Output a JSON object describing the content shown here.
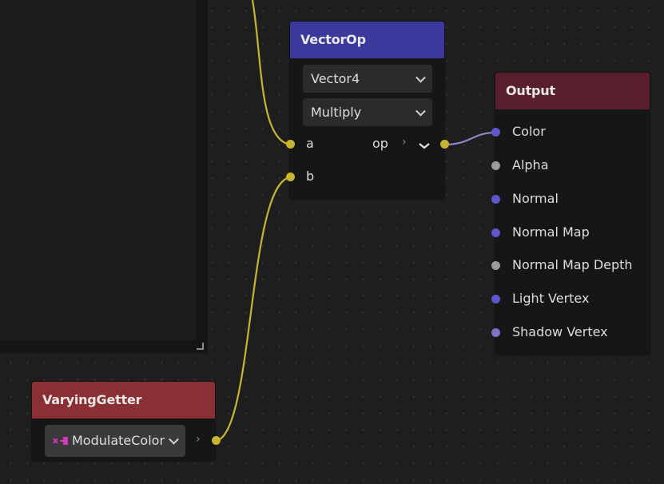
{
  "colors": {
    "background": "#1e1e1e",
    "wire": "#c9b431",
    "wire_to_output": "#8d86c4",
    "vectorop_header": "#3b3a9c",
    "output_header": "#5a1f2c",
    "varying_header": "#8a2f33",
    "port_float": "#9b9b9b",
    "port_vector": "#5d58c9"
  },
  "vector_op": {
    "title": "VectorOp",
    "type_select": "Vector4",
    "op_select": "Multiply",
    "inputs": [
      {
        "label": "a",
        "icon": "yellow-port-icon"
      },
      {
        "label": "b",
        "icon": "yellow-port-icon"
      }
    ],
    "output": {
      "label": "op",
      "icon": "yellow-port-icon"
    }
  },
  "output_node": {
    "title": "Output",
    "ports": [
      {
        "label": "Color",
        "icon": "blue-port-icon"
      },
      {
        "label": "Alpha",
        "icon": "grey-port-icon"
      },
      {
        "label": "Normal",
        "icon": "blue-port-icon"
      },
      {
        "label": "Normal Map",
        "icon": "blue-port-icon"
      },
      {
        "label": "Normal Map Depth",
        "icon": "grey-port-icon"
      },
      {
        "label": "Light Vertex",
        "icon": "blue-port-icon"
      },
      {
        "label": "Shadow Vertex",
        "icon": "purple-port-icon"
      }
    ]
  },
  "varying_getter": {
    "title": "VaryingGetter",
    "selected": "ModulateColor",
    "icon": "varying-icon"
  }
}
